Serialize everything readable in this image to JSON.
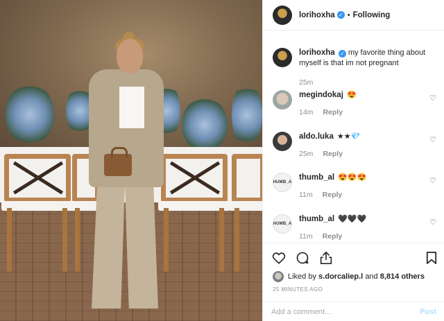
{
  "header": {
    "username": "lorihoxha",
    "separator": "•",
    "follow_status": "Following"
  },
  "caption": {
    "username": "lorihoxha",
    "text": "my favorite thing about myself is that im not pregnant",
    "time": "25m"
  },
  "comments": [
    {
      "username": "megindokaj",
      "text": "😍",
      "time": "14m",
      "reply_label": "Reply"
    },
    {
      "username": "aldo.luka",
      "text": "★★💎",
      "time": "25m",
      "reply_label": "Reply"
    },
    {
      "username": "thumb_al",
      "text": "😍😍😍",
      "time": "11m",
      "reply_label": "Reply",
      "avatar_text": "THUMB_AL"
    },
    {
      "username": "thumb_al",
      "text": "🖤🖤🖤",
      "time": "11m",
      "reply_label": "Reply",
      "avatar_text": "THUMB_AL"
    }
  ],
  "likes": {
    "prefix": "Liked by",
    "liker": "s.dorcaliep.l",
    "connector": "and",
    "others": "8,814 others"
  },
  "posted_ago": "25 MINUTES AGO",
  "add_comment": {
    "placeholder": "Add a comment...",
    "post_label": "Post"
  },
  "colors": {
    "verified": "#3897f0",
    "muted_text": "#8e8e8e",
    "post_disabled": "#b2dffc"
  },
  "icons": [
    "heart-icon",
    "comment-icon",
    "share-icon",
    "bookmark-icon",
    "verified-icon"
  ]
}
